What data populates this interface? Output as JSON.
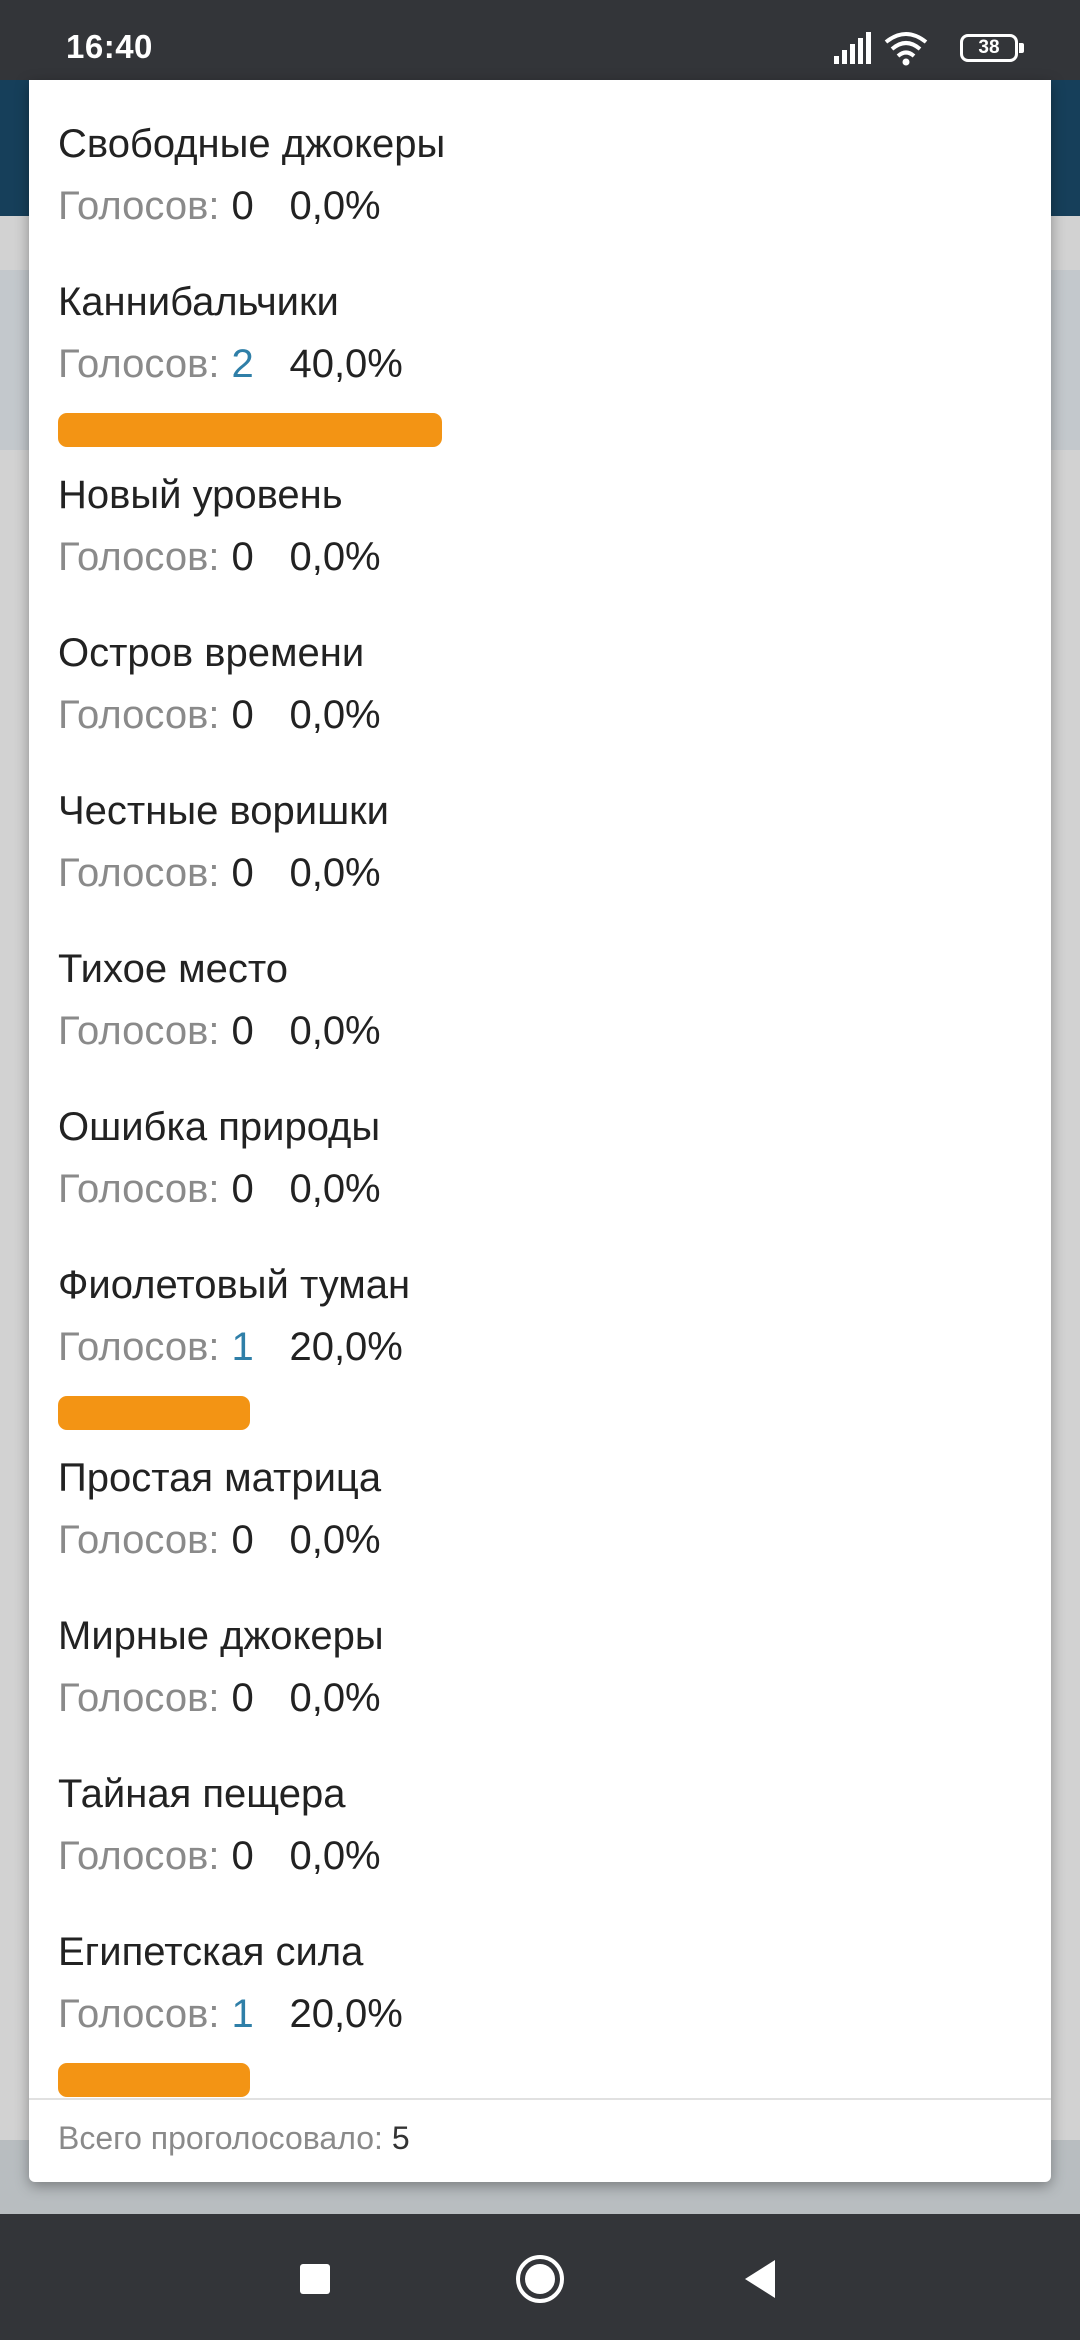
{
  "status_bar": {
    "time": "16:40",
    "battery": "38"
  },
  "poll": {
    "options": [
      {
        "name": "Свободные джокеры",
        "votes_label": "Голосов:",
        "votes": "0",
        "percent": "0,0%",
        "share": 0
      },
      {
        "name": "Каннибальчики",
        "votes_label": "Голосов:",
        "votes": "2",
        "percent": "40,0%",
        "share": 40
      },
      {
        "name": "Новый уровень",
        "votes_label": "Голосов:",
        "votes": "0",
        "percent": "0,0%",
        "share": 0
      },
      {
        "name": "Остров времени",
        "votes_label": "Голосов:",
        "votes": "0",
        "percent": "0,0%",
        "share": 0
      },
      {
        "name": "Честные воришки",
        "votes_label": "Голосов:",
        "votes": "0",
        "percent": "0,0%",
        "share": 0
      },
      {
        "name": "Тихое место",
        "votes_label": "Голосов:",
        "votes": "0",
        "percent": "0,0%",
        "share": 0
      },
      {
        "name": "Ошибка природы",
        "votes_label": "Голосов:",
        "votes": "0",
        "percent": "0,0%",
        "share": 0
      },
      {
        "name": "Фиолетовый туман",
        "votes_label": "Голосов:",
        "votes": "1",
        "percent": "20,0%",
        "share": 20
      },
      {
        "name": "Простая матрица",
        "votes_label": "Голосов:",
        "votes": "0",
        "percent": "0,0%",
        "share": 0
      },
      {
        "name": "Мирные джокеры",
        "votes_label": "Голосов:",
        "votes": "0",
        "percent": "0,0%",
        "share": 0
      },
      {
        "name": "Тайная пещера",
        "votes_label": "Голосов:",
        "votes": "0",
        "percent": "0,0%",
        "share": 0
      },
      {
        "name": "Египетская сила",
        "votes_label": "Голосов:",
        "votes": "1",
        "percent": "20,0%",
        "share": 20
      }
    ],
    "total_label": "Всего проголосовало:",
    "total_value": "5"
  },
  "colors": {
    "bar": "#f39414",
    "vote_count_nonzero": "#2f7fa8",
    "muted_text": "#8a8a8a"
  },
  "icons": {
    "signal": "signal-icon",
    "wifi": "wifi-icon",
    "battery": "battery-icon",
    "nav_recents": "square-icon",
    "nav_home": "circle-icon",
    "nav_back": "triangle-back-icon"
  }
}
